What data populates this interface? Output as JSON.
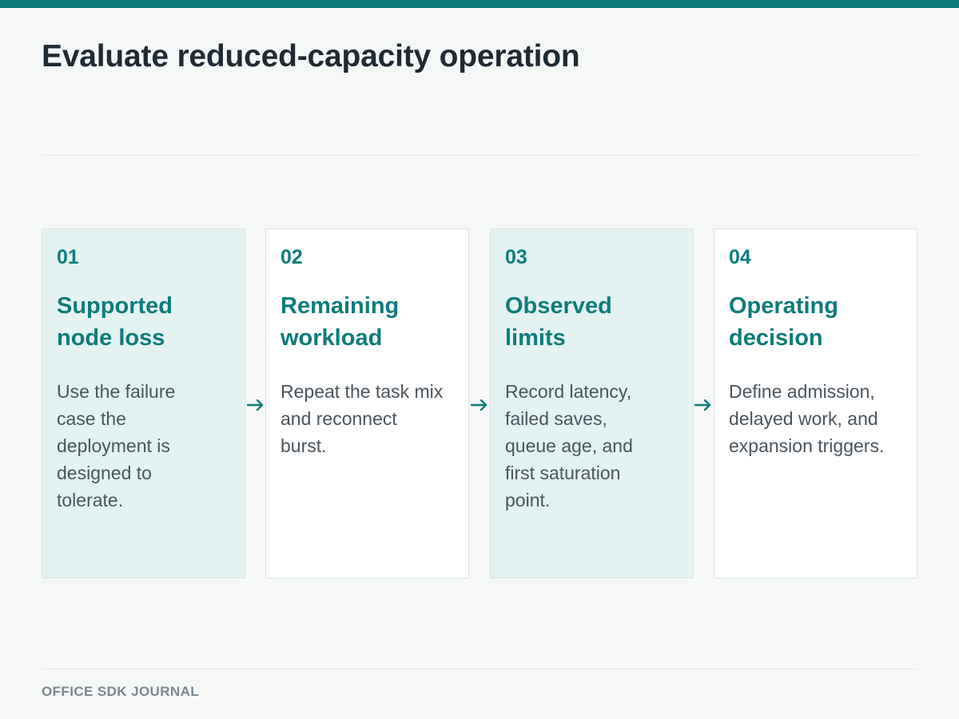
{
  "title": "Evaluate reduced-capacity operation",
  "accent_color": "#0e7c7b",
  "steps": [
    {
      "number": "01",
      "title": "Supported node loss",
      "body": "Use the failure case the deployment is designed to tolerate."
    },
    {
      "number": "02",
      "title": "Remaining workload",
      "body": "Repeat the task mix and reconnect burst."
    },
    {
      "number": "03",
      "title": "Observed limits",
      "body": "Record latency, failed saves, queue age, and first saturation point."
    },
    {
      "number": "04",
      "title": "Operating decision",
      "body": "Define admission, delayed work, and expansion triggers."
    }
  ],
  "footer": "OFFICE SDK JOURNAL"
}
